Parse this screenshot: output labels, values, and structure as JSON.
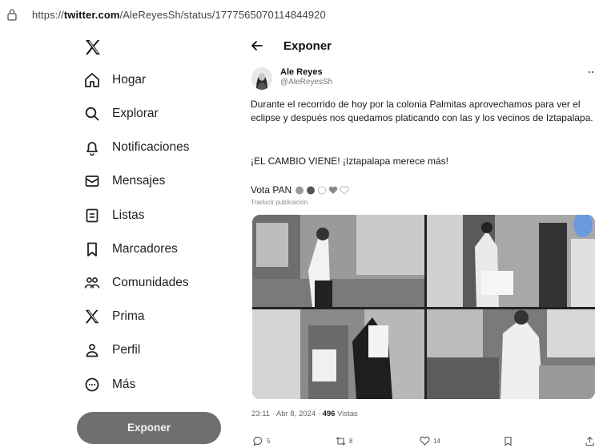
{
  "browser": {
    "url_prefix": "https://",
    "url_domain": "twitter.com",
    "url_path": "/AleReyesSh/status/1777565070114844920"
  },
  "sidebar": {
    "items": [
      {
        "label": "Hogar",
        "icon": "home-icon"
      },
      {
        "label": "Explorar",
        "icon": "search-icon"
      },
      {
        "label": "Notificaciones",
        "icon": "bell-icon"
      },
      {
        "label": "Mensajes",
        "icon": "envelope-icon"
      },
      {
        "label": "Listas",
        "icon": "list-icon"
      },
      {
        "label": "Marcadores",
        "icon": "bookmark-icon"
      },
      {
        "label": "Comunidades",
        "icon": "people-icon"
      },
      {
        "label": "Prima",
        "icon": "x-logo-icon"
      },
      {
        "label": "Perfil",
        "icon": "user-icon"
      },
      {
        "label": "Más",
        "icon": "more-circle-icon"
      }
    ],
    "post_button": "Exponer"
  },
  "header": {
    "title": "Exponer"
  },
  "tweet": {
    "author_name": "Ale Reyes",
    "author_handle": "@AleReyesSh",
    "text": "Durante el recorrido de hoy por la colonia Palmitas aprovechamos para ver el eclipse y después nos quedamos platicando con las y los vecinos de Iztapalapa.",
    "text2": "¡EL CAMBIO VIENE! ¡Iztapalapa merece más!",
    "vota": "Vota PAN",
    "translate": "Traducir publicación",
    "time": "23:11 · Abr 8, 2024 ·",
    "views_count": "496",
    "views_label": "Vistas"
  },
  "actions": {
    "replies": "5",
    "reposts": "8",
    "likes": "14"
  },
  "colors": {
    "post_button": "#6f6f6f",
    "text": "#1a1a1a",
    "muted": "#777777"
  }
}
